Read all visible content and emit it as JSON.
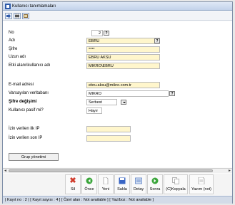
{
  "window": {
    "title": "Kullanıcı tanımlamaları"
  },
  "form": {
    "no": {
      "label": "No",
      "value": "2"
    },
    "adi": {
      "label": "Adı",
      "value": "EBRU"
    },
    "sifre": {
      "label": "Şifre",
      "value": "****"
    },
    "uzun_adi": {
      "label": "Uzun adı",
      "value": "EBRU AKSU"
    },
    "etki_alani": {
      "label": "Etki alanı\\kullanıcı adı",
      "value": "MIKRO\\EBRU"
    },
    "email": {
      "label": "E-mail adresi",
      "value": "ebru.aksu@mikro.com.tr"
    },
    "vt": {
      "label": "Varsayılan veritabanı",
      "value": "MIKRO"
    },
    "sifre_degisimi": {
      "label": "Şifre değişimi",
      "value": "Serbest"
    },
    "pasif": {
      "label": "Kullanıcı pasif mi?",
      "value": "Hayır"
    },
    "izin_ilk": {
      "label": "İzin verilen ilk IP",
      "value": ""
    },
    "izin_son": {
      "label": "İzin verilen son IP",
      "value": ""
    },
    "grup_button": "Grup yönetimi",
    "question_mark": "?"
  },
  "actions": [
    {
      "label": "Sil",
      "icon": "delete-icon",
      "color": "#d03a2a"
    },
    {
      "label": "Önce",
      "icon": "previous-icon",
      "color": "#3aa53a"
    },
    {
      "label": "Yeni",
      "icon": "new-icon",
      "color": "#e6e6e6"
    },
    {
      "label": "Sakla",
      "icon": "save-icon",
      "color": "#3a66c4"
    },
    {
      "label": "Detay",
      "icon": "detail-icon",
      "color": "#5a7fc4"
    },
    {
      "label": "Sonra",
      "icon": "next-icon",
      "color": "#3aa53a"
    },
    {
      "label": "(C)Kopyala",
      "icon": "copy-icon",
      "color": "#e6e6e6"
    },
    {
      "label": "Yazım (not)",
      "icon": "note-icon",
      "color": "#e6e6e6"
    }
  ],
  "status": "| Kayıt no : 2 | [ Kayıt sayısı : 4 ] [ Özel alan : Not available ] [ Yaz/boz : Not available ]"
}
